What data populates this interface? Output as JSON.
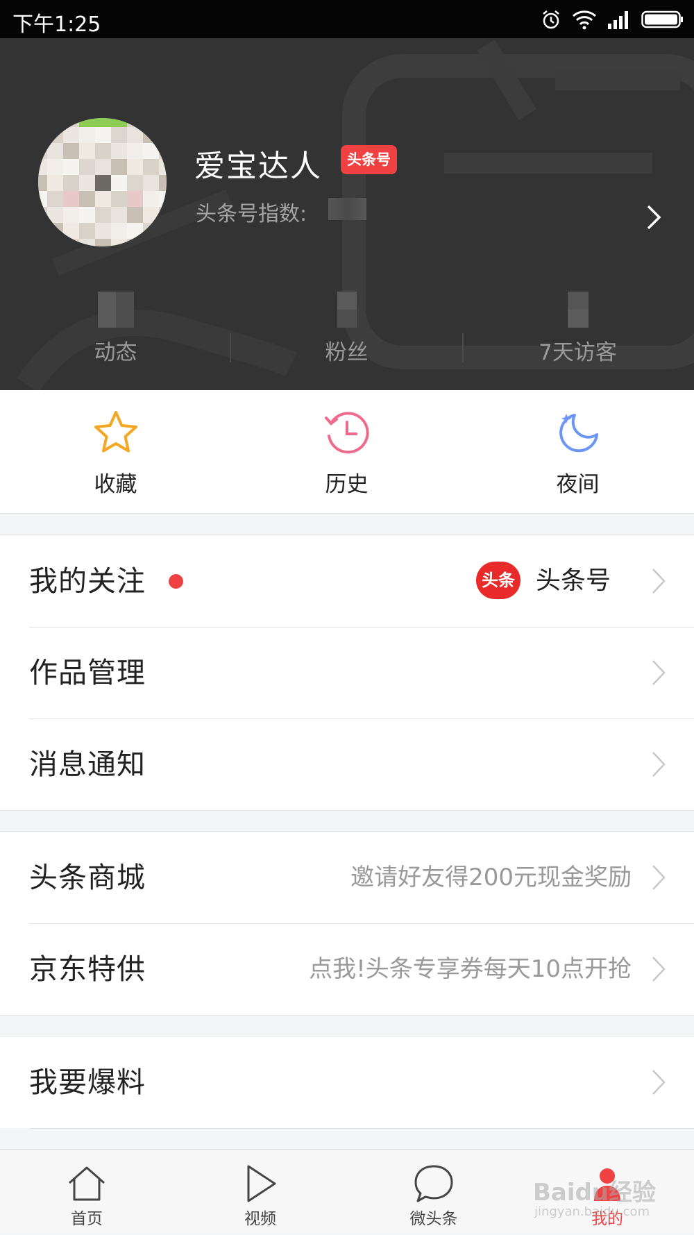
{
  "status_bar": {
    "time": "下午1:25"
  },
  "profile": {
    "username": "爱宝达人",
    "badge": "头条号",
    "index_label": "头条号指数:",
    "stats": [
      {
        "label": "动态"
      },
      {
        "label": "粉丝"
      },
      {
        "label": "7天访客"
      }
    ]
  },
  "quick_actions": [
    {
      "label": "收藏",
      "icon": "star-icon",
      "color": "#f5a623"
    },
    {
      "label": "历史",
      "icon": "history-clock-icon",
      "color": "#f06a8c"
    },
    {
      "label": "夜间",
      "icon": "moon-icon",
      "color": "#6b96f5"
    }
  ],
  "menu_group_1": [
    {
      "title": "我的关注",
      "has_dot": true,
      "logo_text": "头条",
      "right_text": "头条号"
    },
    {
      "title": "作品管理"
    },
    {
      "title": "消息通知"
    }
  ],
  "menu_group_2": [
    {
      "title": "头条商城",
      "subtitle": "邀请好友得200元现金奖励"
    },
    {
      "title": "京东特供",
      "subtitle": "点我!头条专享券每天10点开抢"
    }
  ],
  "menu_group_3": [
    {
      "title": "我要爆料"
    }
  ],
  "tab_bar": [
    {
      "label": "首页",
      "icon": "home-icon"
    },
    {
      "label": "视频",
      "icon": "play-icon"
    },
    {
      "label": "微头条",
      "icon": "chat-bubble-icon"
    },
    {
      "label": "我的",
      "icon": "profile-icon",
      "active": true
    }
  ],
  "colors": {
    "accent": "#f04142",
    "header_bg": "#333333"
  },
  "watermark": {
    "brand": "Baidu经验",
    "url": "jingyan.baidu.com"
  }
}
